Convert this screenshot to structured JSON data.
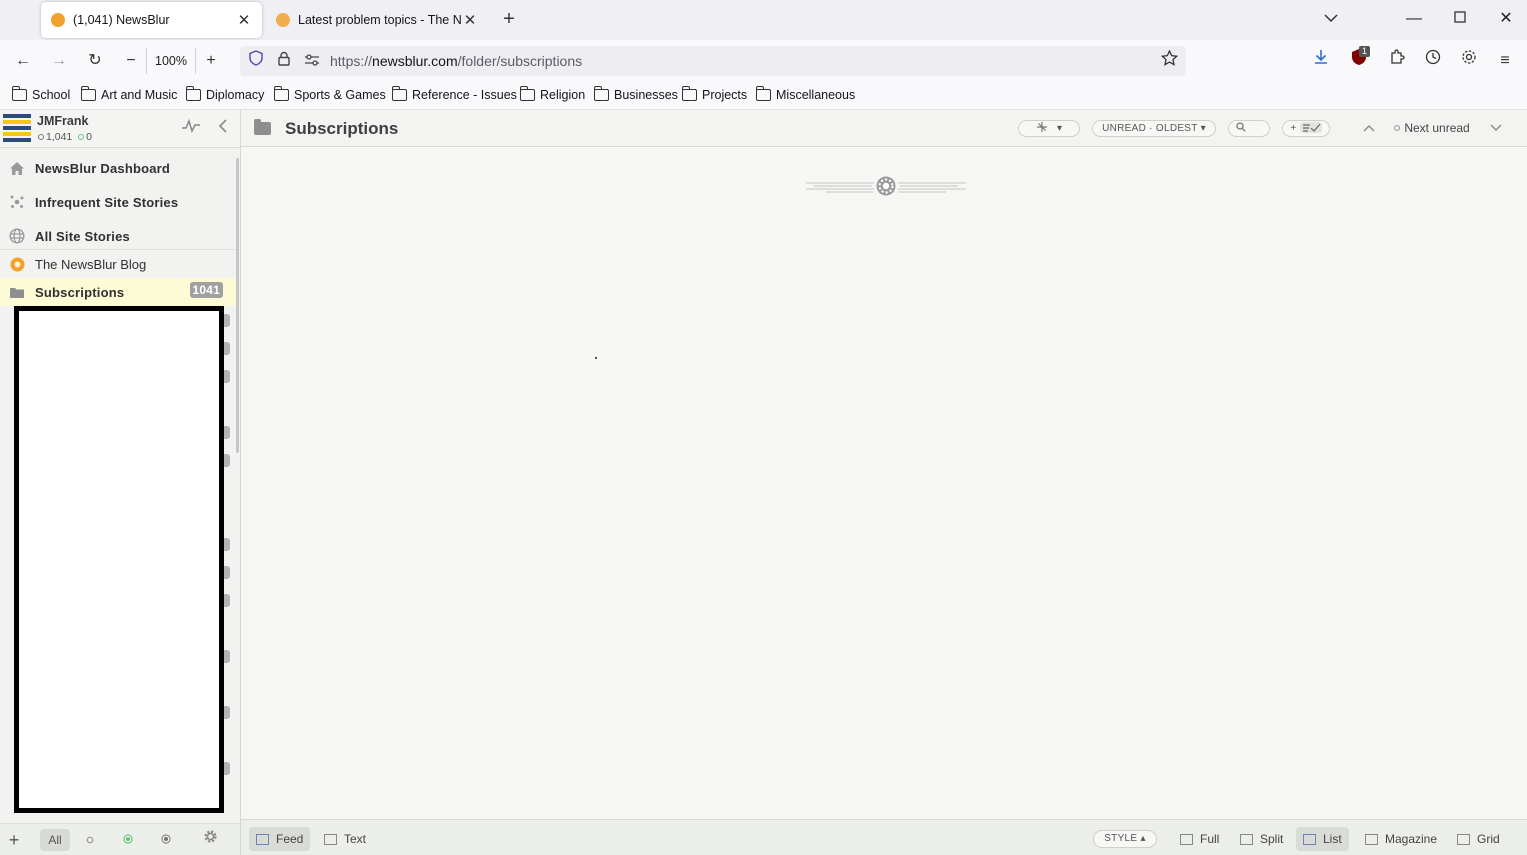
{
  "browser": {
    "tabs": [
      {
        "title": "(1,041) NewsBlur",
        "active": true
      },
      {
        "title": "Latest problem topics - The Ne",
        "active": false
      }
    ],
    "zoom": "100%",
    "url_prefix": "https://",
    "url_host": "newsblur.com",
    "url_path": "/folder/subscriptions",
    "bookmarks": [
      "School",
      "Art and Music",
      "Diplomacy",
      "Sports & Games",
      "Reference - Issues",
      "Religion",
      "Businesses",
      "Projects",
      "Miscellaneous"
    ],
    "extension_badge": "1"
  },
  "sidebar": {
    "username": "JMFrank",
    "unread_count": "1,041",
    "focus_count": "0",
    "items": [
      {
        "label": "NewsBlur Dashboard",
        "icon": "home-icon"
      },
      {
        "label": "Infrequent Site Stories",
        "icon": "infrequent-icon"
      },
      {
        "label": "All Site Stories",
        "icon": "globe-icon"
      },
      {
        "label": "The NewsBlur Blog",
        "icon": "newsblur-favicon"
      },
      {
        "label": "Subscriptions",
        "icon": "folder-icon",
        "count": "1041"
      }
    ],
    "footer_filter": "All"
  },
  "content": {
    "title": "Subscriptions",
    "order": "UNREAD · OLDEST",
    "next_unread": "Next unread",
    "footer": {
      "left": [
        "Feed",
        "Text"
      ],
      "style": "STYLE",
      "layouts": [
        "Full",
        "Split",
        "List",
        "Magazine",
        "Grid"
      ],
      "active_layout": "List"
    }
  },
  "colors": {
    "accent_yellow": "#fcfbd6",
    "newsblur_orange": "#f2a22c",
    "logo_blue": "#2c4a7c",
    "logo_yellow": "#f5c518"
  }
}
